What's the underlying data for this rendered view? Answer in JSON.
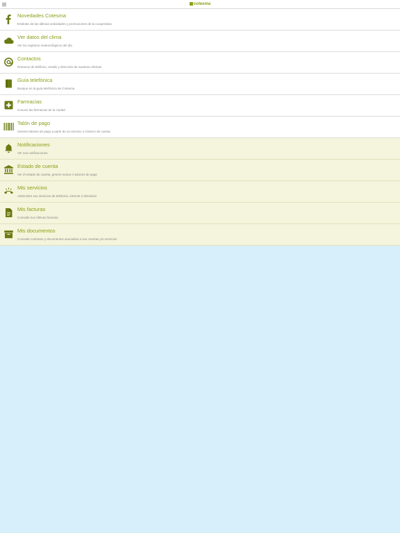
{
  "header": {
    "brand": "cotesma",
    "menu_icon": "hamburger-menu-icon"
  },
  "colors": {
    "accent": "#8aa117",
    "icon": "#6b7a12",
    "account_bg": "#f5f4dc",
    "background": "#d6effb"
  },
  "items": [
    {
      "title": "Novedades Cotesma",
      "desc": "Entérate de las últimas actividades y promociones de la cooperativa",
      "icon": "facebook-icon"
    },
    {
      "title": "Ver datos del clima",
      "desc": "Ver los registros meteorológicos del día",
      "icon": "cloud-icon"
    },
    {
      "title": "Contactos",
      "desc": "Números de teléfono, emails y dirección de nuestras oficinas",
      "icon": "contact-icon"
    },
    {
      "title": "Guía telefónica",
      "desc": "Busque en la guía telefónica de Cotesma",
      "icon": "book-icon"
    },
    {
      "title": "Farmacias",
      "desc": "Conoce las farmacias de la ciudad",
      "icon": "plus-icon"
    },
    {
      "title": "Talón de pago",
      "desc": "Genere talones de pago a partir de un servicio ó número de cuenta",
      "icon": "barcode-icon"
    },
    {
      "title": "Notificaciones",
      "desc": "Ver sus notificaciones",
      "icon": "bell-icon"
    },
    {
      "title": "Estado de cuenta",
      "desc": "Ver el estado de cuenta, genere avisos ó talones de pago",
      "icon": "bank-icon"
    },
    {
      "title": "Mis servicios",
      "desc": "Administre sus servicios de telefonía, internet ó televisión",
      "icon": "phone-icon"
    },
    {
      "title": "Mis facturas",
      "desc": "Consulte sus últimas facturas",
      "icon": "invoice-icon"
    },
    {
      "title": "Mis documentos",
      "desc": "Consulte contratos y documentos asociados a sus cuentas y/o servicios",
      "icon": "archive-icon"
    }
  ]
}
